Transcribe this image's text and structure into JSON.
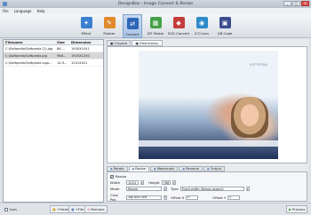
{
  "window": {
    "title": "DesignBox - Image Convert & Resize",
    "minimize": "_",
    "maximize": "□",
    "close": "✕"
  },
  "menu": [
    "File",
    "Language",
    "Help"
  ],
  "toolbar": [
    {
      "label": "Effect",
      "icon": "effect-icon",
      "color": "#3b7fd1",
      "glyph": "✦"
    },
    {
      "label": "Painter",
      "icon": "painter-icon",
      "color": "#e08a2b",
      "glyph": "✎"
    },
    {
      "label": "Convert",
      "icon": "convert-icon",
      "color": "#2f67b8",
      "glyph": "⇄",
      "active": true
    },
    {
      "label": "GIF Maker",
      "icon": "gif-maker-icon",
      "color": "#46a046",
      "glyph": "▦"
    },
    {
      "label": "SVG Convert",
      "icon": "svg-convert-icon",
      "color": "#c43c3c",
      "glyph": "◆"
    },
    {
      "label": "ICO Icon",
      "icon": "ico-icon",
      "color": "#2d8bc9",
      "glyph": "◉"
    },
    {
      "label": "QR Code",
      "icon": "qr-code-icon",
      "color": "#3a4d8f",
      "glyph": "▣"
    }
  ],
  "filelist": {
    "headers": [
      "Filename",
      "Size",
      "Dimension"
    ],
    "rows": [
      {
        "name": "C:\\Softpedia\\Softpedia (2).jpg",
        "size": "86....",
        "dim": "1400X1041"
      },
      {
        "name": "C:\\Softpedia\\Softpedia.jpg",
        "size": "988...",
        "dim": "1920X1200"
      },
      {
        "name": "C:\\Softpedia\\Softpedia logo...",
        "size": "14.9...",
        "dim": "1201X421"
      }
    ],
    "selected": 1
  },
  "preview_tabs": [
    "Original",
    "Destination"
  ],
  "preview_watermark": "SOFTPEDIA",
  "settings_tabs": [
    "Rotate",
    "Resize",
    "Watermark",
    "Rename",
    "Output"
  ],
  "settings_active_tab": 1,
  "resize": {
    "resize_label": "Resize",
    "resize_checked": true,
    "width_label": "Width",
    "width_value": "1024",
    "height_label": "Height",
    "height_value": "768",
    "mode_label": "Mode",
    "mode_value": "Resize",
    "type_label": "Type",
    "type_value": "Fixed width (Keeps aspect)",
    "crop_label": "Crop Pos",
    "crop_value": "Top and Left",
    "offsetx_label": "Offset X",
    "offsetx_value": "0",
    "offsety_label": "Offset Y",
    "offsety_value": "0"
  },
  "bottom": {
    "icon_label": "Icon",
    "add_folder": "+Folder",
    "add_file": "+File",
    "remove": "Remove",
    "process": "Process"
  }
}
